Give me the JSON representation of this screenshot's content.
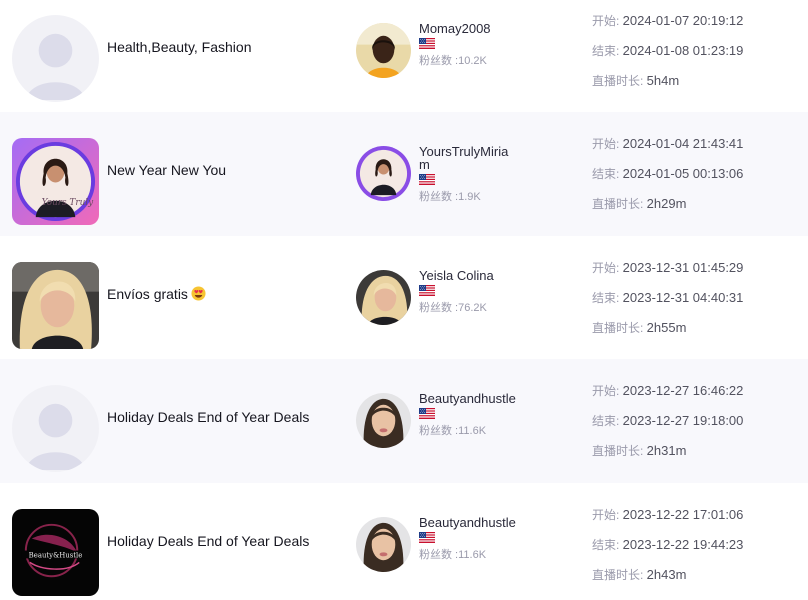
{
  "streams": [
    {
      "title": "Health,Beauty, Fashion",
      "cover_icon": "default-avatar-icon",
      "user": {
        "name": "Momay2008",
        "fans": "10.2K",
        "country": "us-flag-icon"
      },
      "start": "2024-01-07 20:19:12",
      "end": "2024-01-08 01:23:19",
      "duration": "5h4m"
    },
    {
      "title": "New Year New You",
      "cover_icon": "yourstruly-cover-image",
      "user": {
        "name": "YoursTrulyMiriam",
        "fans": "1.9K",
        "country": "us-flag-icon"
      },
      "start": "2024-01-04 21:43:41",
      "end": "2024-01-05 00:13:06",
      "duration": "2h29m"
    },
    {
      "title": "Envíos gratis",
      "title_emoji": "heart-eyes-emoji-icon",
      "cover_icon": "selfie-cover-image",
      "user": {
        "name": "Yeisla Colina",
        "fans": "76.2K",
        "country": "us-flag-icon"
      },
      "start": "2023-12-31 01:45:29",
      "end": "2023-12-31 04:40:31",
      "duration": "2h55m"
    },
    {
      "title": "Holiday Deals End of Year Deals",
      "cover_icon": "default-avatar-icon",
      "user": {
        "name": "Beautyandhustle",
        "fans": "11.6K",
        "country": "us-flag-icon"
      },
      "start": "2023-12-27 16:46:22",
      "end": "2023-12-27 19:18:00",
      "duration": "2h31m"
    },
    {
      "title": "Holiday Deals End of Year Deals",
      "cover_icon": "beauty-logo-cover-image",
      "user": {
        "name": "Beautyandhustle",
        "fans": "11.6K",
        "country": "us-flag-icon"
      },
      "start": "2023-12-22 17:01:06",
      "end": "2023-12-22 19:44:23",
      "duration": "2h43m"
    }
  ],
  "labels": {
    "start": "开始: ",
    "end": "结束: ",
    "duration": "直播时长: ",
    "fans_prefix": "粉丝数 :"
  },
  "colors": {
    "alt_row_bg": "#f8f8fc",
    "muted_text": "#9a9aab",
    "primary_text": "#16161f"
  }
}
